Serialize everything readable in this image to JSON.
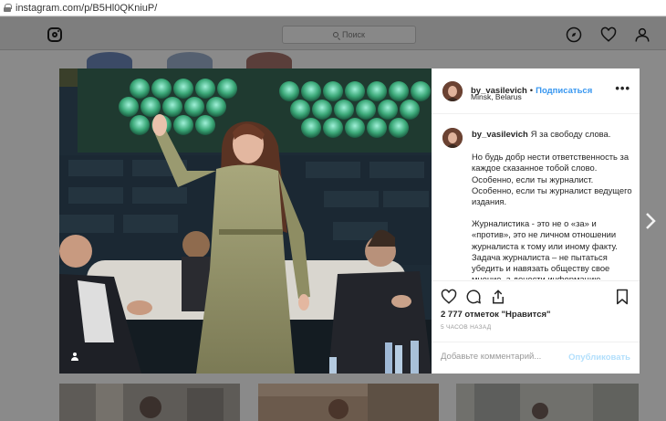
{
  "browser": {
    "url": "instagram.com/p/B5Hl0QKniuP/"
  },
  "header": {
    "search_placeholder": "Поиск",
    "icons": [
      "instagram-logo-icon",
      "explore-compass-icon",
      "heart-icon",
      "profile-icon"
    ]
  },
  "post": {
    "username": "by_vasilevich",
    "follow_label": "Подписаться",
    "separator": "•",
    "location": "Minsk, Belarus",
    "more_label": "•••",
    "caption": {
      "username": "by_vasilevich",
      "first": "Я за свободу слова.",
      "p2": "Но будь добр нести ответственность за каждое сказанное тобой слово. Особенно, если ты журналист. Особенно, если ты журналист ведущего издания.",
      "p3": "Журналистика - это не о «за» и «против», это не личном отношении журналиста к тому или иному факту. Задача журналиста – не пытаться убедить и навязать обществу свое мнение, а донести информацию"
    },
    "likes": "2 777 отметок \"Нравится\"",
    "time_ago": "5 ЧАСОВ НАЗАД",
    "comment_placeholder": "Добавьте комментарий...",
    "publish_label": "Опубликовать",
    "action_icons": [
      "heart-icon",
      "comment-icon",
      "share-icon",
      "bookmark-icon"
    ]
  },
  "colors": {
    "link_blue": "#3897f0",
    "publish_disabled": "#b2dffc",
    "text": "#262626",
    "muted": "#999999"
  }
}
